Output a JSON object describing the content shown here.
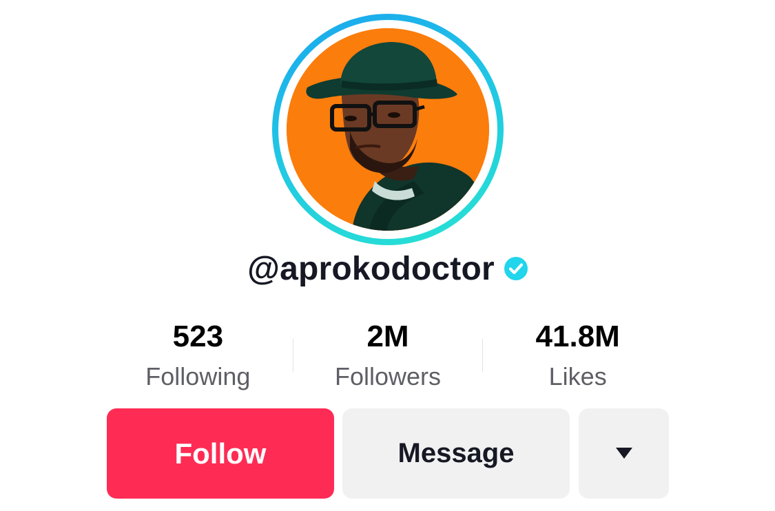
{
  "profile": {
    "username": "@aprokodoctor",
    "verified": true,
    "avatar_icon": "profile-photo"
  },
  "stats": [
    {
      "value": "523",
      "label": "Following"
    },
    {
      "value": "2M",
      "label": "Followers"
    },
    {
      "value": "41.8M",
      "label": "Likes"
    }
  ],
  "actions": {
    "follow_label": "Follow",
    "message_label": "Message",
    "more_icon": "caret-down-icon"
  },
  "colors": {
    "follow_bg": "#fe2c55",
    "secondary_bg": "#f1f1f2",
    "verified": "#20d5ec",
    "ring_start": "#1aa6ee",
    "ring_end": "#28e3d2",
    "avatar_bg": "#fb7d0c"
  }
}
